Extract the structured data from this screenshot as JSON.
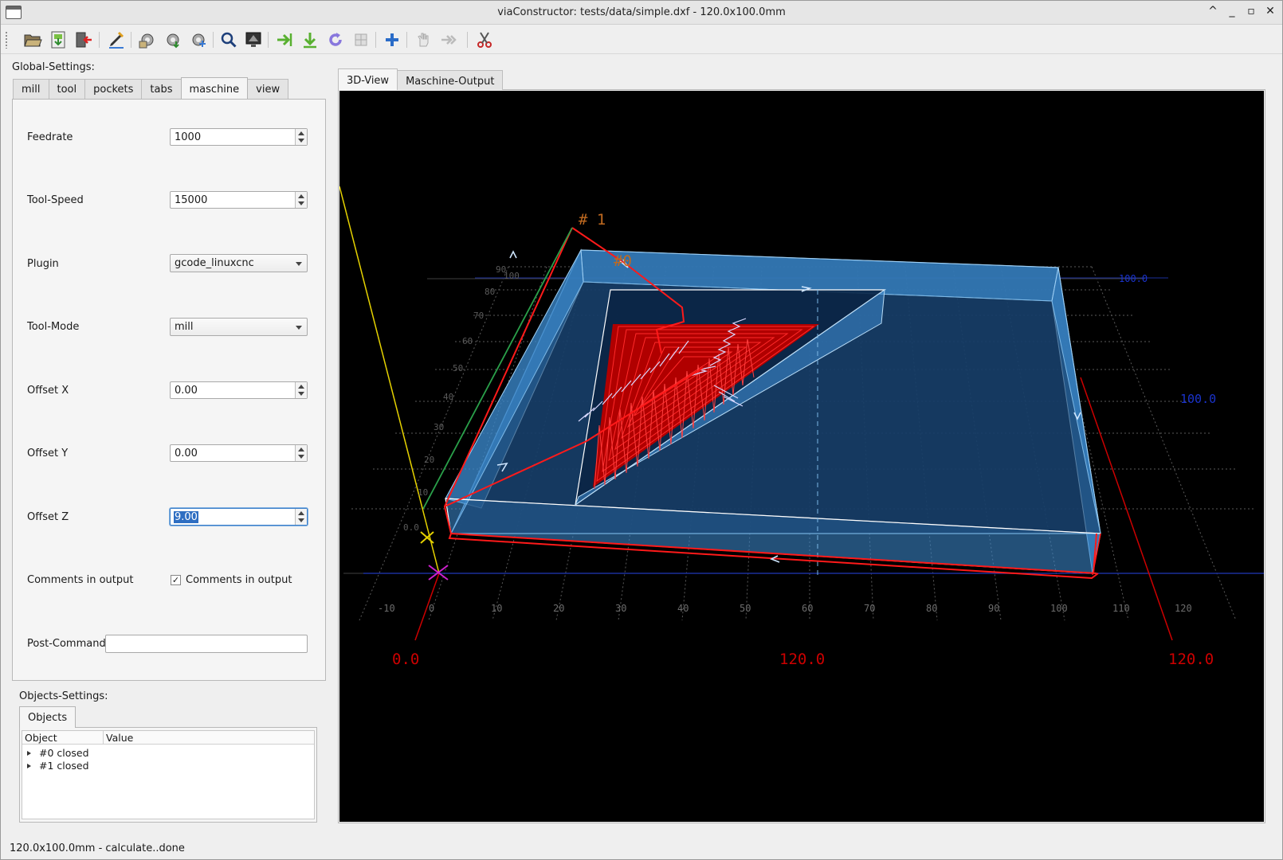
{
  "window": {
    "title": "viaConstructor: tests/data/simple.dxf - 120.0x100.0mm",
    "controls": [
      "^",
      "_",
      "▫",
      "✕"
    ]
  },
  "toolbar": {
    "buttons": [
      {
        "name": "open-file",
        "icon": "folder-open-icon"
      },
      {
        "name": "save-output",
        "icon": "save-icon"
      },
      {
        "name": "exit",
        "icon": "exit-icon"
      },
      {
        "name": "edit",
        "icon": "pencil-icon"
      },
      {
        "name": "setup-load",
        "icon": "settings-load-icon"
      },
      {
        "name": "setup-save",
        "icon": "settings-save-icon"
      },
      {
        "name": "setup-save-as",
        "icon": "settings-save-as-icon"
      },
      {
        "name": "view-zoom",
        "icon": "magnifier-icon"
      },
      {
        "name": "view-screen",
        "icon": "monitor-icon"
      },
      {
        "name": "machine-send",
        "icon": "arrow-right-icon"
      },
      {
        "name": "machine-download",
        "icon": "arrow-down-icon"
      },
      {
        "name": "reload",
        "icon": "reload-icon"
      },
      {
        "name": "disabled-tool",
        "icon": "grid-icon"
      },
      {
        "name": "add-object",
        "icon": "plus-icon"
      },
      {
        "name": "select",
        "icon": "hand-icon"
      },
      {
        "name": "order",
        "icon": "order-arrows-icon"
      },
      {
        "name": "cut",
        "icon": "scissors-icon"
      }
    ]
  },
  "global_settings": {
    "title": "Global-Settings:",
    "tabs": [
      "mill",
      "tool",
      "pockets",
      "tabs",
      "maschine",
      "view"
    ],
    "active_tab": "maschine",
    "fields": {
      "feedrate": {
        "label": "Feedrate",
        "value": "1000"
      },
      "tool_speed": {
        "label": "Tool-Speed",
        "value": "15000"
      },
      "plugin": {
        "label": "Plugin",
        "value": "gcode_linuxcnc"
      },
      "tool_mode": {
        "label": "Tool-Mode",
        "value": "mill"
      },
      "offset_x": {
        "label": "Offset X",
        "value": "0.00"
      },
      "offset_y": {
        "label": "Offset Y",
        "value": "0.00"
      },
      "offset_z": {
        "label": "Offset Z",
        "value": "9.00"
      },
      "comments": {
        "label": "Comments in output",
        "checkbox_label": "Comments in output",
        "checked": true,
        "mark": "✓"
      },
      "post_command": {
        "label": "Post-Command",
        "value": ""
      }
    }
  },
  "objects_settings": {
    "title": "Objects-Settings:",
    "tab": "Objects",
    "columns": [
      "Object",
      "Value"
    ],
    "items": [
      "#0 closed",
      "#1 closed"
    ]
  },
  "view_tabs": [
    "3D-View",
    "Maschine-Output"
  ],
  "view3d": {
    "object_labels": [
      "# 1",
      "#0"
    ],
    "axis_values": {
      "x_left": "0.0",
      "x_mid": "120.0",
      "x_right": "120.0",
      "y_right": "100.0",
      "y_top": "100.0"
    },
    "x_ticks": [
      "-10",
      "0",
      "10",
      "20",
      "30",
      "40",
      "50",
      "60",
      "70",
      "80",
      "90",
      "100",
      "110",
      "120"
    ],
    "y_ticks": [
      "0.0",
      "10",
      "20",
      "30",
      "40",
      "50",
      "60",
      "70",
      "80",
      "90",
      "100"
    ],
    "colors": {
      "background": "#000000",
      "workpiece": "#3f8fcf",
      "toolpath": "#ff1a1a",
      "outline": "#ffffff",
      "axis_x": "#cc0000",
      "axis_y": "#2aa04a",
      "axis_z": "#e6d200",
      "grid": "#707070",
      "label_x": "#cc0000",
      "label_y": "#1a33cc"
    }
  },
  "status": "120.0x100.0mm - calculate..done"
}
